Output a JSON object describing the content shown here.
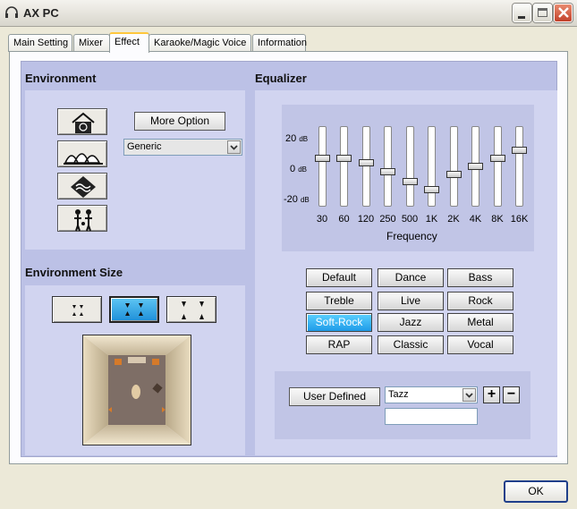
{
  "window": {
    "title": "AX PC"
  },
  "tabs": [
    {
      "label": "Main Setting"
    },
    {
      "label": "Mixer"
    },
    {
      "label": "Effect"
    },
    {
      "label": "Karaoke/Magic Voice"
    },
    {
      "label": "Information"
    }
  ],
  "active_tab": "Effect",
  "environment": {
    "title": "Environment",
    "more_option_label": "More Option",
    "preset_value": "Generic",
    "buttons": [
      "house-icon",
      "opera-house-icon",
      "cave-icon",
      "concert-icon"
    ]
  },
  "environment_size": {
    "title": "Environment Size",
    "selected_index": 1,
    "sizes": [
      "small-size-icon",
      "medium-size-icon",
      "large-size-icon"
    ]
  },
  "equalizer": {
    "title": "Equalizer",
    "ticks": [
      {
        "value": "20",
        "unit": "dB"
      },
      {
        "value": "0",
        "unit": "dB"
      },
      {
        "value": "-20",
        "unit": "dB"
      }
    ],
    "range_db": [
      -20,
      20
    ],
    "bands": [
      {
        "label": "30",
        "gain_db": 5
      },
      {
        "label": "60",
        "gain_db": 5
      },
      {
        "label": "120",
        "gain_db": 2
      },
      {
        "label": "250",
        "gain_db": -3
      },
      {
        "label": "500",
        "gain_db": -9
      },
      {
        "label": "1K",
        "gain_db": -14
      },
      {
        "label": "2K",
        "gain_db": -5
      },
      {
        "label": "4K",
        "gain_db": 0
      },
      {
        "label": "8K",
        "gain_db": 5
      },
      {
        "label": "16K",
        "gain_db": 10
      }
    ],
    "xlabel": "Frequency",
    "presets": [
      "Default",
      "Dance",
      "Bass",
      "Treble",
      "Live",
      "Rock",
      "Soft-Rock",
      "Jazz",
      "Metal",
      "RAP",
      "Classic",
      "Vocal"
    ],
    "active_preset": "Soft-Rock",
    "user_defined_label": "User  Defined",
    "user_preset_value": "Tazz",
    "user_name_value": "",
    "add_label": "+",
    "remove_label": "−"
  },
  "footer": {
    "ok_label": "OK"
  },
  "colors": {
    "accent": "#1e9be8",
    "panel": "#d1d4f0",
    "content_bg": "#bcc1e6"
  }
}
